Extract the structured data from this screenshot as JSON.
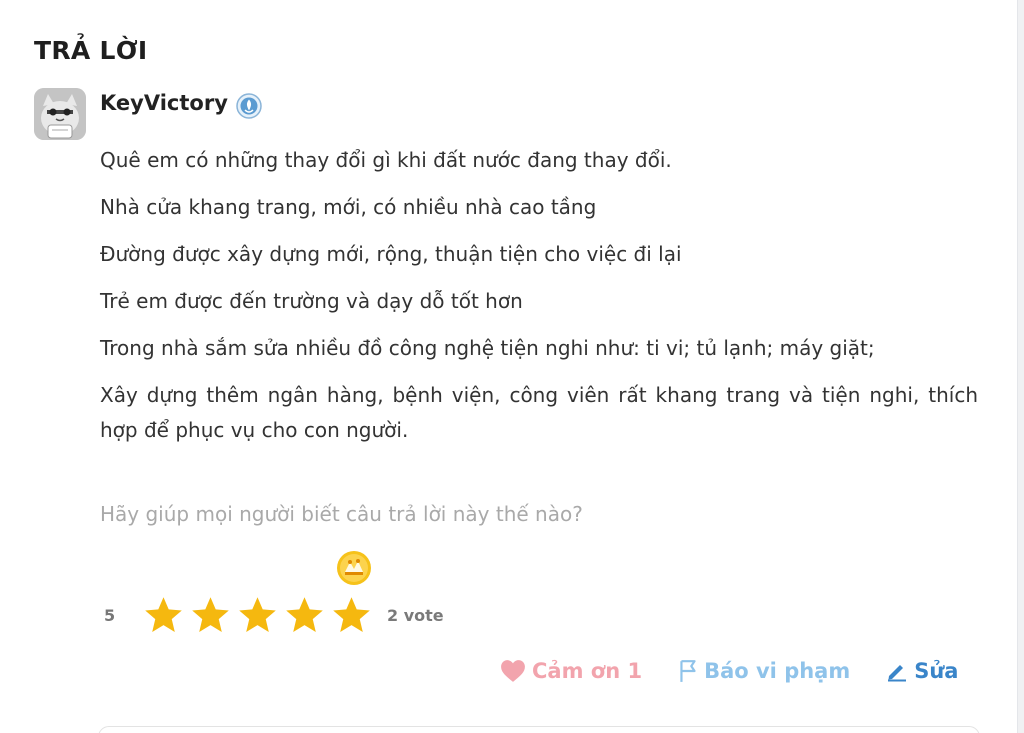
{
  "section": {
    "title": "TRẢ LỜI"
  },
  "answer": {
    "author": "KeyVictory",
    "lines": [
      "Quê em có những thay đổi gì khi đất nước đang thay đổi.",
      "Nhà cửa khang trang, mới, có nhiều nhà cao tầng",
      "Đường được xây dựng mới, rộng, thuận tiện cho việc đi lại",
      "Trẻ em được đến trường và dạy dỗ tốt hơn",
      "Trong nhà sắm sửa nhiều đồ công nghệ tiện nghi như: ti vi; tủ lạnh; máy giặt;",
      "Xây dựng thêm ngân hàng, bệnh viện, công viên rất khang trang và tiện nghi, thích hợp để phục vụ cho con người."
    ]
  },
  "feedback": {
    "prompt": "Hãy giúp mọi người biết câu trả lời này thế nào?",
    "score": "5",
    "stars_filled": 5,
    "stars_total": 5,
    "votes": "2 vote"
  },
  "actions": {
    "thanks_label": "Cảm ơn 1",
    "report_label": "Báo vi phạm",
    "edit_label": "Sửa"
  },
  "colors": {
    "star": "#f5b80f",
    "thanks": "#f2a4ad",
    "report": "#8fc3ea",
    "edit": "#3a85c9",
    "prompt_text": "#a9a9a9"
  }
}
